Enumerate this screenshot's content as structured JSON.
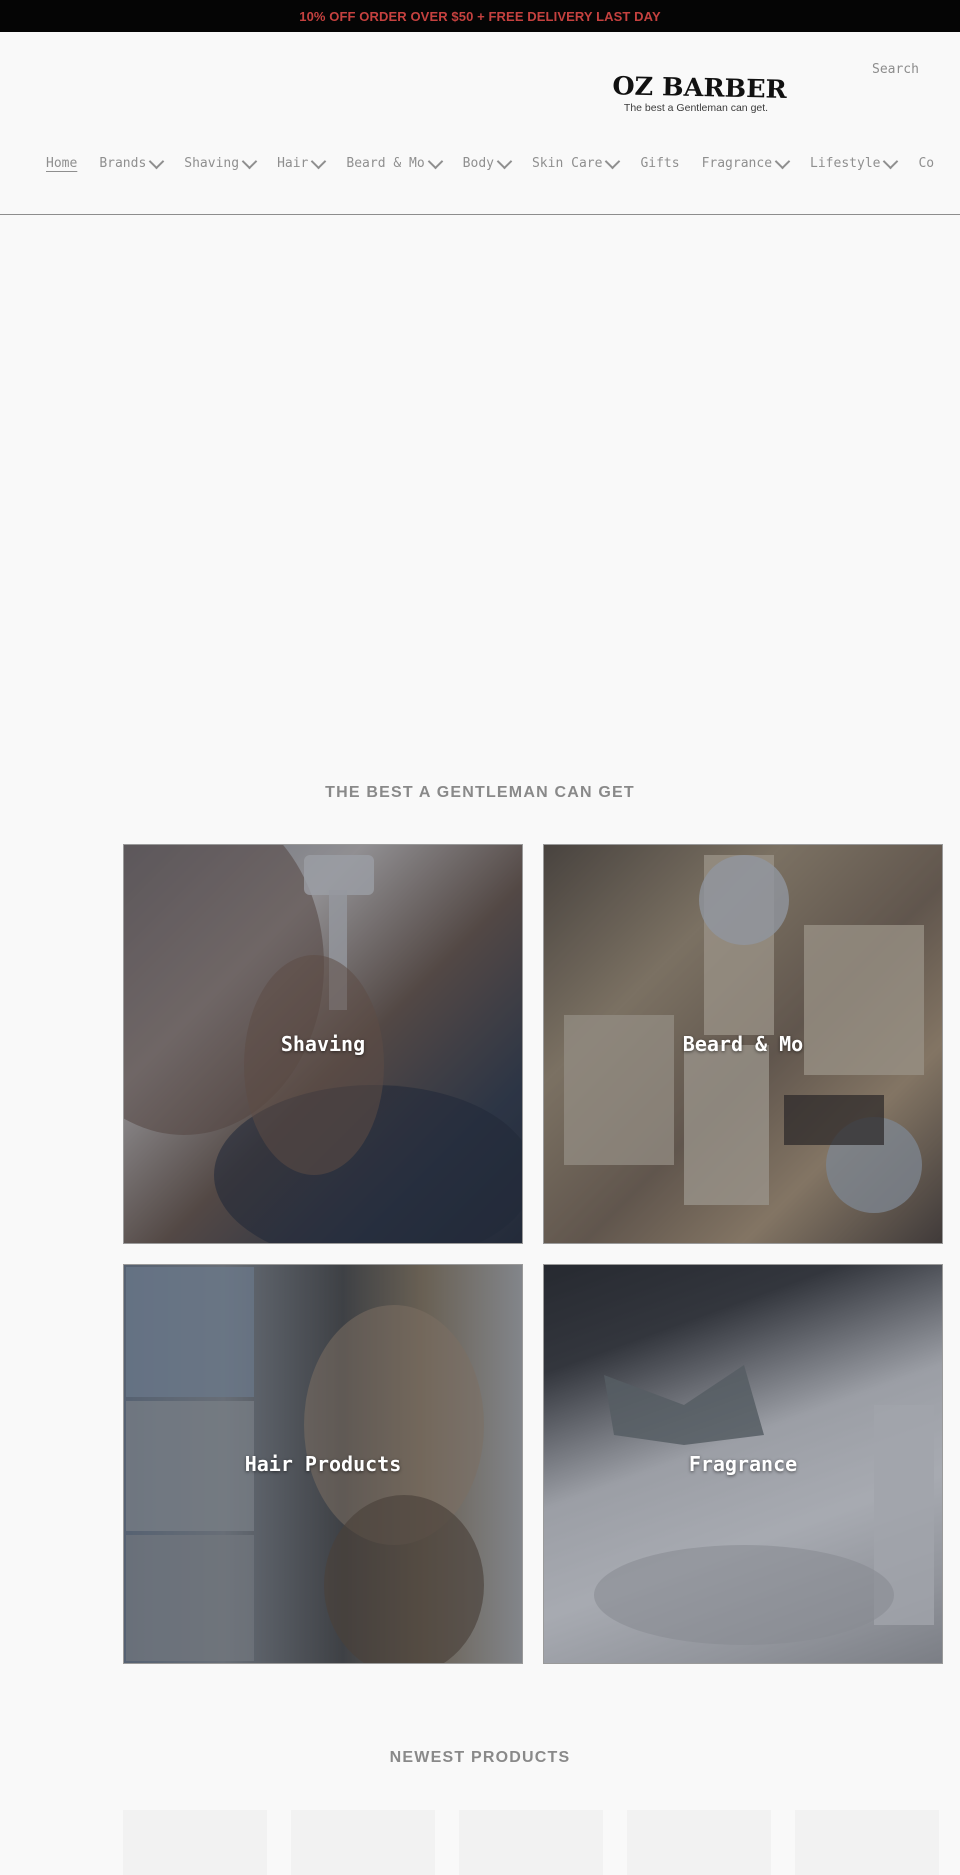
{
  "announcement": {
    "text": "10% OFF ORDER OVER $50 + FREE DELIVERY LAST DAY"
  },
  "header": {
    "logo_title": "OZ BARBER",
    "logo_tagline": "The best a Gentleman can get.",
    "search_label": "Search"
  },
  "nav": {
    "items": [
      {
        "label": "Home",
        "active": true,
        "has_dropdown": false
      },
      {
        "label": "Brands",
        "active": false,
        "has_dropdown": true
      },
      {
        "label": "Shaving",
        "active": false,
        "has_dropdown": true
      },
      {
        "label": "Hair",
        "active": false,
        "has_dropdown": true
      },
      {
        "label": "Beard & Mo",
        "active": false,
        "has_dropdown": true
      },
      {
        "label": "Body",
        "active": false,
        "has_dropdown": true
      },
      {
        "label": "Skin Care",
        "active": false,
        "has_dropdown": true
      },
      {
        "label": "Gifts",
        "active": false,
        "has_dropdown": false
      },
      {
        "label": "Fragrance",
        "active": false,
        "has_dropdown": true
      },
      {
        "label": "Lifestyle",
        "active": false,
        "has_dropdown": true
      },
      {
        "label": "Co",
        "active": false,
        "has_dropdown": false
      }
    ]
  },
  "collections": {
    "title": "THE BEST A GENTLEMAN CAN GET",
    "tiles": [
      {
        "label": "Shaving"
      },
      {
        "label": "Beard & Mo"
      },
      {
        "label": "Hair Products"
      },
      {
        "label": "Fragrance"
      }
    ]
  },
  "newest": {
    "title": "NEWEST PRODUCTS"
  },
  "colors": {
    "announcement_bg": "#050505",
    "announcement_text": "#c5413f",
    "page_bg": "#f9f9f9"
  }
}
